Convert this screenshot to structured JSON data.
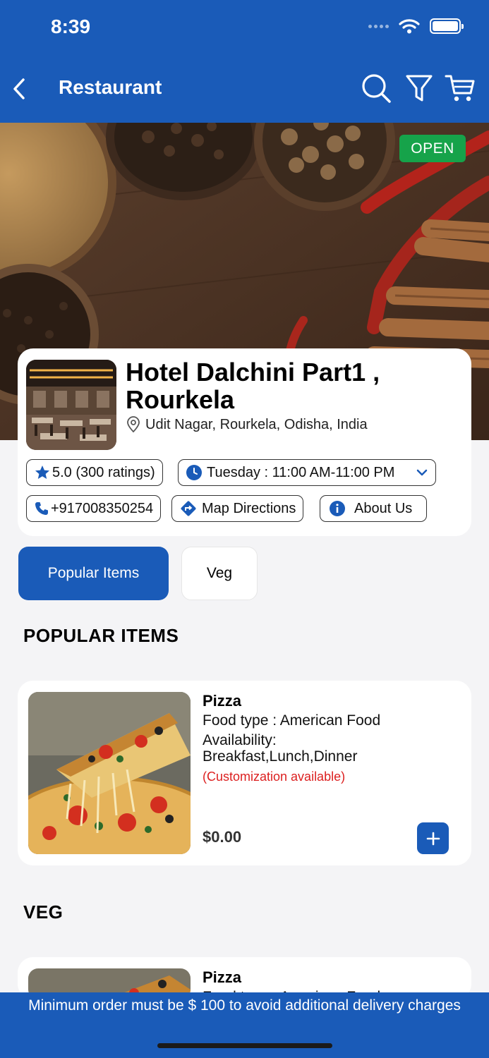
{
  "status_bar": {
    "time": "8:39"
  },
  "header": {
    "title": "Restaurant"
  },
  "hero": {
    "status_badge": "OPEN"
  },
  "restaurant": {
    "name": "Hotel Dalchini Part1 , Rourkela",
    "address": "Udit Nagar, Rourkela, Odisha, India",
    "rating": "5.0 (300 ratings)",
    "hours": "Tuesday : 11:00 AM-11:00 PM",
    "phone": "+917008350254",
    "map_label": "Map Directions",
    "about_label": "About Us"
  },
  "tabs": [
    {
      "label": "Popular Items",
      "active": true
    },
    {
      "label": "Veg",
      "active": false
    }
  ],
  "sections": [
    {
      "heading": "POPULAR ITEMS",
      "items": [
        {
          "name": "Pizza",
          "food_type": "Food type : American Food",
          "availability_label": "Availability:",
          "availability": "Breakfast,Lunch,Dinner",
          "customization": "(Customization available)",
          "price": "$0.00"
        }
      ]
    },
    {
      "heading": "VEG",
      "items": [
        {
          "name": "Pizza",
          "food_type": "Food type : American Food"
        }
      ]
    }
  ],
  "footer": {
    "notice": "Minimum order must be $ 100 to avoid additional delivery charges"
  },
  "colors": {
    "primary": "#1a5bb8",
    "open_green": "#16a34a",
    "custom_red": "#dc1f1f",
    "background": "#f4f4f6"
  },
  "icons": [
    "back-arrow-icon",
    "search-icon",
    "filter-icon",
    "cart-icon",
    "location-pin-icon",
    "star-icon",
    "clock-icon",
    "chevron-down-icon",
    "phone-icon",
    "directions-icon",
    "info-icon",
    "plus-icon"
  ]
}
